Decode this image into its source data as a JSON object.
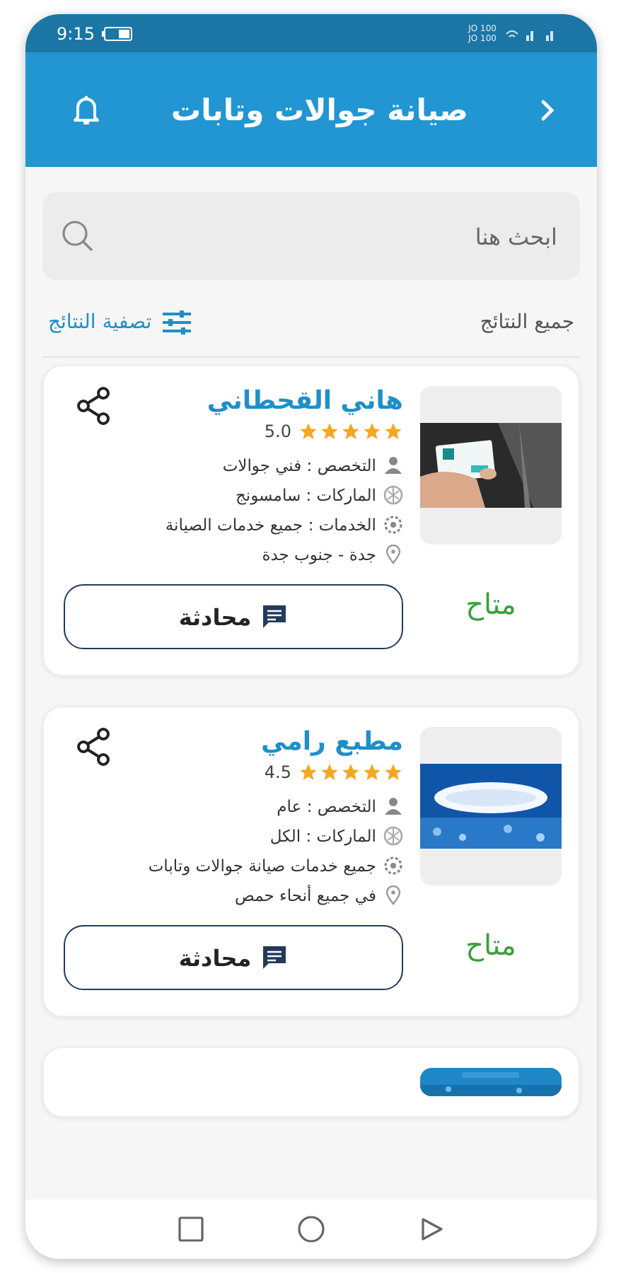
{
  "status_bar": {
    "time": "9:15",
    "carrier_lines": [
      "JO 100",
      "JO 100"
    ]
  },
  "header": {
    "title": "صيانة جوالات وتابات"
  },
  "search": {
    "placeholder": "ابحث هنا"
  },
  "results": {
    "label": "جميع النتائج",
    "filter_link": "تصفية النتائج"
  },
  "providers": [
    {
      "name": "هاني القحطاني",
      "stars": 5,
      "rating": "5.0",
      "details": [
        {
          "kind": "specialty",
          "text": "التخصص : فني جوالات"
        },
        {
          "kind": "brands",
          "text": "الماركات : سامسونج"
        },
        {
          "kind": "services",
          "text": "الخدمات : جميع خدمات الصيانة"
        },
        {
          "kind": "location",
          "text": "جدة  -  جنوب جدة"
        }
      ],
      "status": "متاح",
      "chat_button": "محادثة"
    },
    {
      "name": "مطبع رامي",
      "stars": 5,
      "rating": "4.5",
      "details": [
        {
          "kind": "specialty",
          "text": "التخصص : عام"
        },
        {
          "kind": "brands",
          "text": "الماركات : الكل"
        },
        {
          "kind": "services",
          "text": "جميع خدمات صيانة جوالات وتابات"
        },
        {
          "kind": "location",
          "text": "في جميع أنحاء حمص"
        }
      ],
      "status": "متاح",
      "chat_button": "محادثة"
    }
  ]
}
